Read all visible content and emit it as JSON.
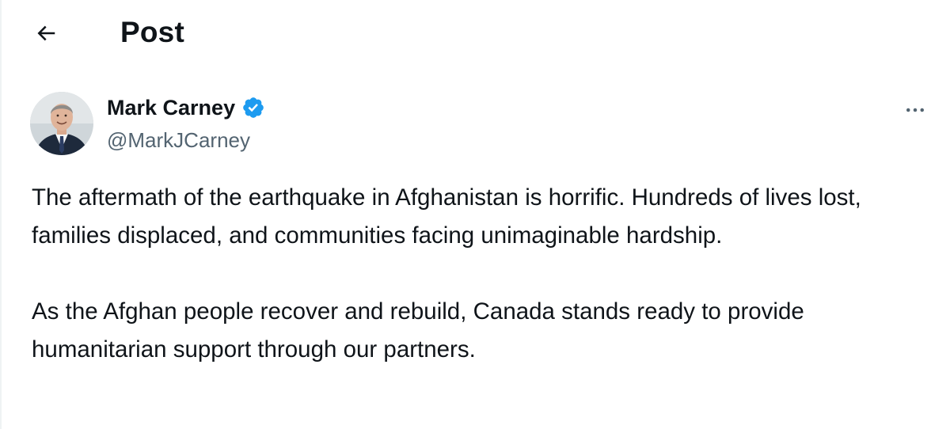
{
  "header": {
    "title": "Post",
    "back_icon": "arrow-left-icon"
  },
  "author": {
    "display_name": "Mark Carney",
    "handle": "@MarkJCarney",
    "verified": true,
    "verified_icon": "verified-badge-icon",
    "verified_color": "#1d9bf0"
  },
  "menu": {
    "icon": "more-horizontal-icon"
  },
  "post": {
    "paragraphs": [
      "The aftermath of the earthquake in Afghanistan is horrific. Hundreds of lives lost, families displaced, and communities facing unimaginable hardship.",
      "As the Afghan people recover and rebuild, Canada stands ready to provide humanitarian support through our partners."
    ]
  },
  "colors": {
    "text_primary": "#0f1419",
    "text_secondary": "#536471",
    "accent": "#1d9bf0",
    "border": "#eff3f4"
  }
}
